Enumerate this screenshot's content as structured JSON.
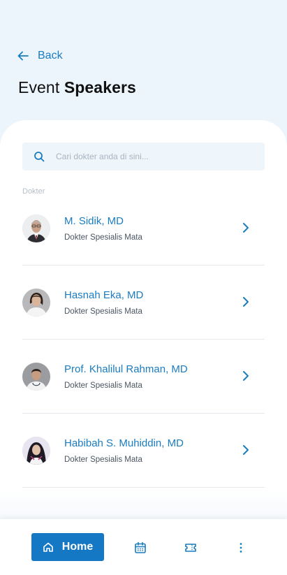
{
  "header": {
    "back_label": "Back",
    "title_regular": "Event",
    "title_bold": "Speakers"
  },
  "search": {
    "placeholder": "Cari dokter anda di sini..."
  },
  "section": {
    "label": "Dokter"
  },
  "doctors": [
    {
      "name": "M. Sidik, MD",
      "specialty": "Dokter Spesialis Mata"
    },
    {
      "name": "Hasnah Eka, MD",
      "specialty": "Dokter Spesialis Mata"
    },
    {
      "name": "Prof. Khalilul Rahman, MD",
      "specialty": "Dokter Spesialis Mata"
    },
    {
      "name": "Habibah S. Muhiddin, MD",
      "specialty": "Dokter Spesialis Mata"
    }
  ],
  "bottom_nav": {
    "home_label": "Home",
    "icons": [
      "home-icon",
      "calendar-icon",
      "ticket-icon",
      "more-vertical-icon"
    ]
  },
  "colors": {
    "accent": "#1478c4",
    "link": "#1a7cc1",
    "background": "#ecf4fc"
  }
}
